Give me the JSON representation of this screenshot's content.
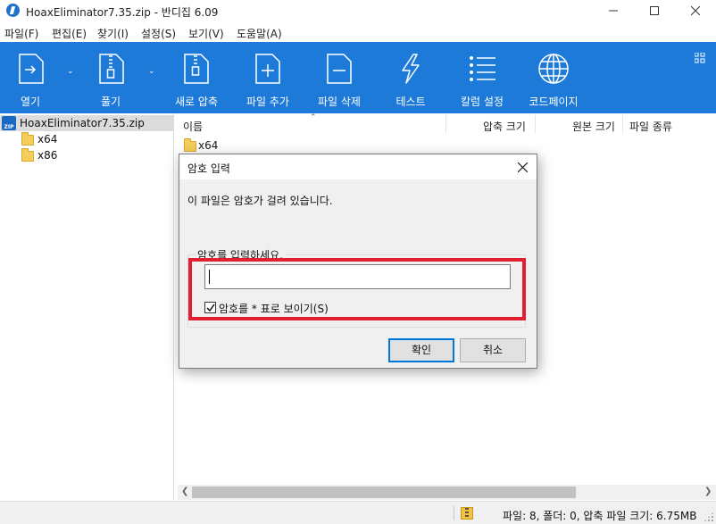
{
  "window": {
    "title": "HoaxEliminator7.35.zip - 반디집 6.09"
  },
  "menu": [
    "파일(F)",
    "편집(E)",
    "찾기(I)",
    "설정(S)",
    "보기(V)",
    "도움말(A)"
  ],
  "toolbar": {
    "open": "열기",
    "extract": "풀기",
    "new_archive": "새로 압축",
    "add_file": "파일 추가",
    "delete_file": "파일 삭제",
    "test": "테스트",
    "settings": "칼럼 설정",
    "codepage": "코드페이지"
  },
  "tree": {
    "root": "HoaxEliminator7.35.zip",
    "children": [
      "x64",
      "x86"
    ]
  },
  "filelist": {
    "columns": [
      "이름",
      "압축 크기",
      "원본 크기",
      "파일 종류"
    ],
    "rows": [
      {
        "name": "x64"
      }
    ]
  },
  "statusbar": {
    "text": "파일: 8, 폴더: 0, 압축 파일 크기: 6.75MB"
  },
  "dialog": {
    "title": "암호 입력",
    "message": "이 파일은 암호가 걸려 있습니다.",
    "group_label": "암호를 입력하세요.",
    "password_value": "",
    "show_as_asterisk_label": "암호를 * 표로 보이기(S)",
    "show_as_asterisk_checked": true,
    "ok_label": "확인",
    "cancel_label": "취소"
  },
  "colors": {
    "toolbar_bg": "#1d7ad8",
    "highlight_border": "#e0202e"
  }
}
